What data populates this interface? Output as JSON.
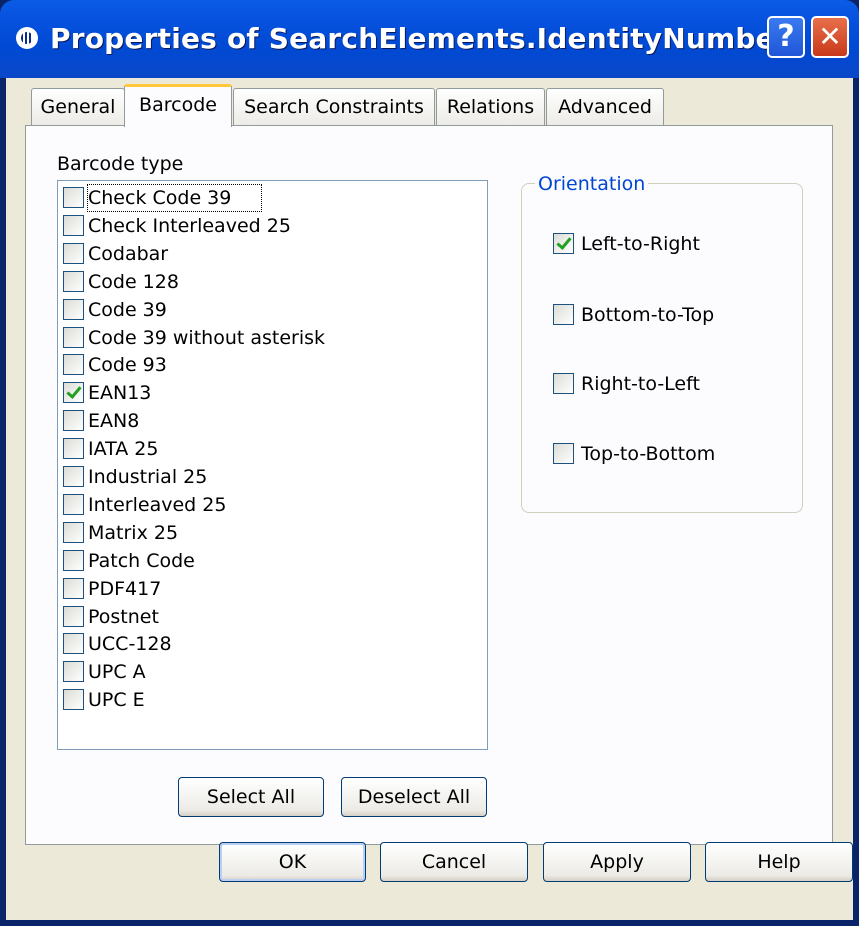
{
  "window": {
    "title": "Properties of SearchElements.IdentityNumber",
    "help_button": "?",
    "close_button": "✕"
  },
  "tabs": [
    {
      "label": "General",
      "active": false
    },
    {
      "label": "Barcode",
      "active": true
    },
    {
      "label": "Search Constraints",
      "active": false
    },
    {
      "label": "Relations",
      "active": false
    },
    {
      "label": "Advanced",
      "active": false
    }
  ],
  "barcode": {
    "list_label": "Barcode type",
    "items": [
      {
        "label": "Check Code 39",
        "checked": false
      },
      {
        "label": "Check Interleaved 25",
        "checked": false
      },
      {
        "label": "Codabar",
        "checked": false
      },
      {
        "label": "Code 128",
        "checked": false
      },
      {
        "label": "Code 39",
        "checked": false
      },
      {
        "label": "Code 39 without asterisk",
        "checked": false
      },
      {
        "label": "Code 93",
        "checked": false
      },
      {
        "label": "EAN13",
        "checked": true
      },
      {
        "label": "EAN8",
        "checked": false
      },
      {
        "label": "IATA 25",
        "checked": false
      },
      {
        "label": "Industrial 25",
        "checked": false
      },
      {
        "label": "Interleaved 25",
        "checked": false
      },
      {
        "label": "Matrix 25",
        "checked": false
      },
      {
        "label": "Patch Code",
        "checked": false
      },
      {
        "label": "PDF417",
        "checked": false
      },
      {
        "label": "Postnet",
        "checked": false
      },
      {
        "label": "UCC-128",
        "checked": false
      },
      {
        "label": "UPC A",
        "checked": false
      },
      {
        "label": "UPC E",
        "checked": false
      }
    ],
    "select_all": "Select All",
    "deselect_all": "Deselect All"
  },
  "orientation": {
    "title": "Orientation",
    "options": [
      {
        "label": "Left-to-Right",
        "checked": true
      },
      {
        "label": "Bottom-to-Top",
        "checked": false
      },
      {
        "label": "Right-to-Left",
        "checked": false
      },
      {
        "label": "Top-to-Bottom",
        "checked": false
      }
    ]
  },
  "footer": {
    "ok": "OK",
    "cancel": "Cancel",
    "apply": "Apply",
    "help": "Help"
  }
}
